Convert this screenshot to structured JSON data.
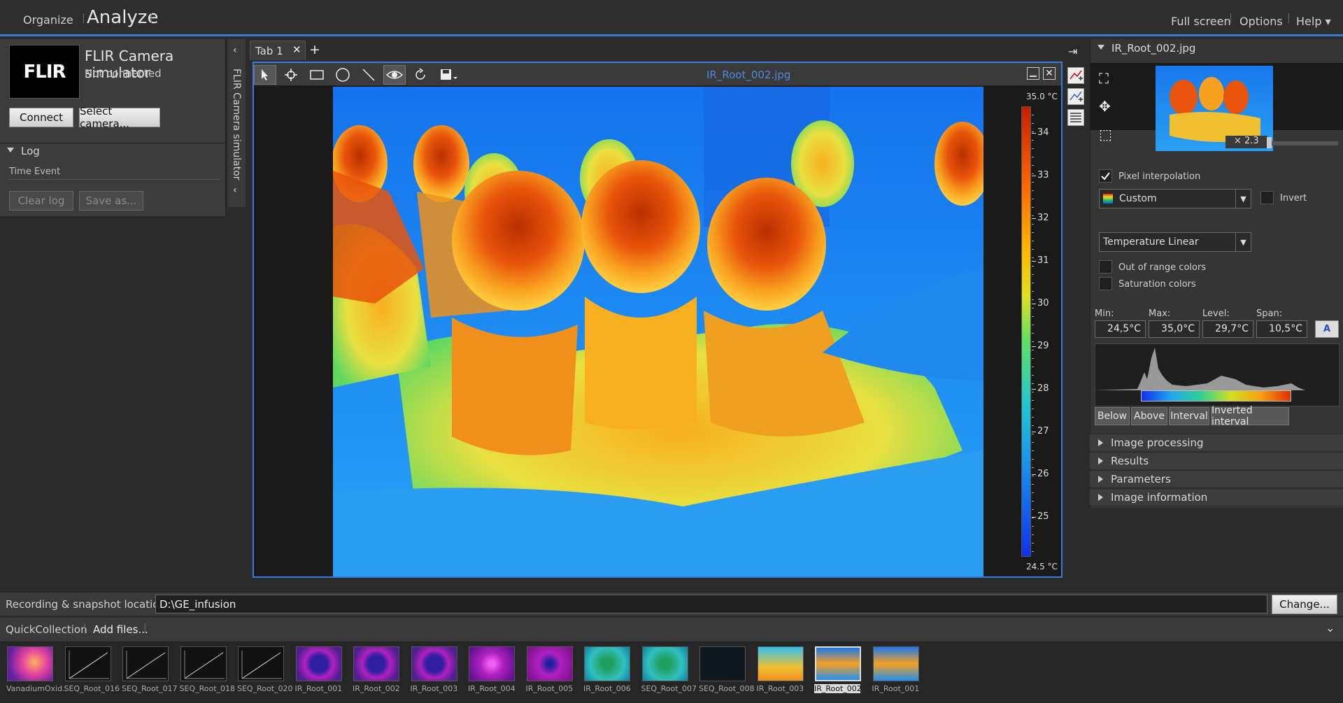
{
  "topbar": {
    "organize": "Organize",
    "analyze": "Analyze",
    "fullscreen": "Full screen",
    "options": "Options",
    "help": "Help ▾"
  },
  "camera": {
    "logo_text": "FLIR",
    "name": "FLIR Camera simulator",
    "status": "Not connected",
    "connect": "Connect",
    "select_camera": "Select camera...",
    "vertical_label": "FLIR Camera simulator"
  },
  "log": {
    "header": "Log",
    "columns": "Time Event",
    "clear": "Clear log",
    "save": "Save as..."
  },
  "tabs": {
    "tab1": "Tab 1",
    "close": "✕",
    "add": "+"
  },
  "image": {
    "title": "IR_Root_002.jpg",
    "scale_max": "35.0 °C",
    "scale_min": "24.5 °C",
    "ticks": [
      "34",
      "33",
      "32",
      "31",
      "30",
      "29",
      "28",
      "27",
      "26",
      "25"
    ]
  },
  "right": {
    "file": "IR_Root_002.jpg",
    "zoom": "× 2.3",
    "pixel_interp": "Pixel interpolation",
    "palette": "Custom",
    "invert": "Invert",
    "scale_mode": "Temperature Linear",
    "out_of_range": "Out of range colors",
    "saturation": "Saturation colors",
    "min_label": "Min:",
    "max_label": "Max:",
    "level_label": "Level:",
    "span_label": "Span:",
    "min": "24,5°C",
    "max": "35,0°C",
    "level": "29,7°C",
    "span": "10,5°C",
    "below": "Below",
    "above": "Above",
    "interval": "Interval",
    "inverted_interval": "Inverted interval",
    "sections": [
      "Image processing",
      "Results",
      "Parameters",
      "Image information"
    ]
  },
  "bottom": {
    "rec_label": "Recording & snapshot location:",
    "rec_path": "D:\\GE_infusion",
    "change": "Change...",
    "quick": "QuickCollection",
    "add_files": "Add files...",
    "thumbs": [
      "VanadiumOxid..",
      "SEQ_Root_016",
      "SEQ_Root_017",
      "SEQ_Root_018",
      "SEQ_Root_020",
      "IR_Root_001",
      "IR_Root_002",
      "IR_Root_003",
      "IR_Root_004",
      "IR_Root_005",
      "IR_Root_006",
      "SEQ_Root_007",
      "SEQ_Root_008",
      "IR_Root_003",
      "IR_Root_002",
      "IR_Root_001"
    ]
  }
}
